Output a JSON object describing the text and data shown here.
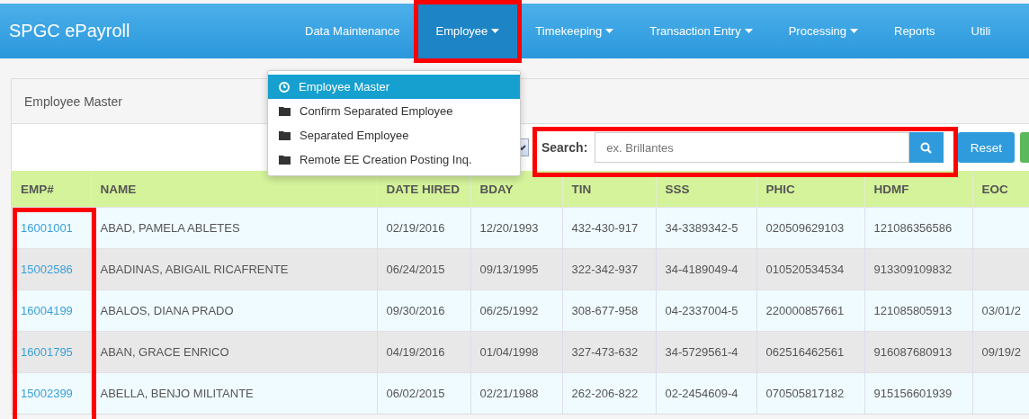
{
  "navbar": {
    "brand": "SPGC ePayroll",
    "items": [
      {
        "label": "Data Maintenance",
        "dropdown": false,
        "selected": false
      },
      {
        "label": "Employee",
        "dropdown": true,
        "selected": true
      },
      {
        "label": "Timekeeping",
        "dropdown": true,
        "selected": false
      },
      {
        "label": "Transaction Entry",
        "dropdown": true,
        "selected": false
      },
      {
        "label": "Processing",
        "dropdown": true,
        "selected": false
      },
      {
        "label": "Reports",
        "dropdown": false,
        "selected": false
      },
      {
        "label": "Utili",
        "dropdown": false,
        "selected": false
      }
    ]
  },
  "dropdown_menu": {
    "items": [
      {
        "label": "Employee Master",
        "kind": "clock",
        "selected": true
      },
      {
        "label": "Confirm Separated Employee",
        "kind": "folder",
        "selected": false
      },
      {
        "label": "Separated Employee",
        "kind": "folder",
        "selected": false
      },
      {
        "label": "Remote EE Creation Posting Inq.",
        "kind": "folder",
        "selected": false
      }
    ]
  },
  "panel": {
    "title": "Employee Master"
  },
  "toolbar": {
    "search_label": "Search:",
    "search": {
      "placeholder": "ex. Brillantes"
    },
    "reset_button": "Reset"
  },
  "table": {
    "columns": [
      "EMP#",
      "NAME",
      "DATE HIRED",
      "BDAY",
      "TIN",
      "SSS",
      "PHIC",
      "HDMF",
      "EOC"
    ],
    "rows": [
      [
        "16001001",
        "ABAD, PAMELA ABLETES",
        "02/19/2016",
        "12/20/1993",
        "432-430-917",
        "34-3389342-5",
        "020509629103",
        "121086356586",
        ""
      ],
      [
        "15002586",
        "ABADINAS, ABIGAIL RICAFRENTE",
        "06/24/2015",
        "09/13/1995",
        "322-342-937",
        "34-4189049-4",
        "010520534534",
        "913309109832",
        ""
      ],
      [
        "16004199",
        "ABALOS, DIANA PRADO",
        "09/30/2016",
        "06/25/1992",
        "308-677-958",
        "04-2337004-5",
        "220000857661",
        "121085805913",
        "03/01/2"
      ],
      [
        "16001795",
        "ABAN, GRACE ENRICO",
        "04/19/2016",
        "01/04/1998",
        "327-473-632",
        "34-5729561-4",
        "062516462561",
        "916087680913",
        "09/19/2"
      ],
      [
        "15002399",
        "ABELLA, BENJO MILITANTE",
        "06/02/2015",
        "02/21/1988",
        "262-206-822",
        "02-2454609-4",
        "070505817182",
        "915156601939",
        ""
      ]
    ]
  }
}
